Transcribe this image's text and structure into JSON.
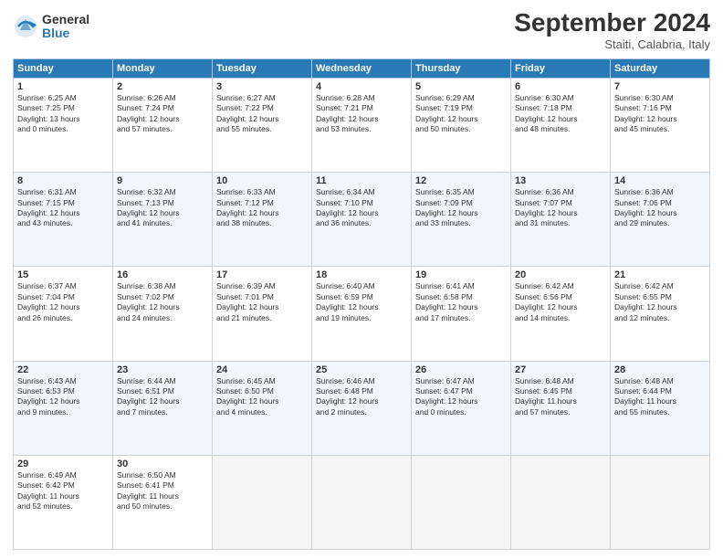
{
  "logo": {
    "general": "General",
    "blue": "Blue"
  },
  "header": {
    "month": "September 2024",
    "location": "Staiti, Calabria, Italy"
  },
  "weekdays": [
    "Sunday",
    "Monday",
    "Tuesday",
    "Wednesday",
    "Thursday",
    "Friday",
    "Saturday"
  ],
  "weeks": [
    [
      {
        "num": "1",
        "info": "Sunrise: 6:25 AM\nSunset: 7:25 PM\nDaylight: 13 hours\nand 0 minutes."
      },
      {
        "num": "2",
        "info": "Sunrise: 6:26 AM\nSunset: 7:24 PM\nDaylight: 12 hours\nand 57 minutes."
      },
      {
        "num": "3",
        "info": "Sunrise: 6:27 AM\nSunset: 7:22 PM\nDaylight: 12 hours\nand 55 minutes."
      },
      {
        "num": "4",
        "info": "Sunrise: 6:28 AM\nSunset: 7:21 PM\nDaylight: 12 hours\nand 53 minutes."
      },
      {
        "num": "5",
        "info": "Sunrise: 6:29 AM\nSunset: 7:19 PM\nDaylight: 12 hours\nand 50 minutes."
      },
      {
        "num": "6",
        "info": "Sunrise: 6:30 AM\nSunset: 7:18 PM\nDaylight: 12 hours\nand 48 minutes."
      },
      {
        "num": "7",
        "info": "Sunrise: 6:30 AM\nSunset: 7:16 PM\nDaylight: 12 hours\nand 45 minutes."
      }
    ],
    [
      {
        "num": "8",
        "info": "Sunrise: 6:31 AM\nSunset: 7:15 PM\nDaylight: 12 hours\nand 43 minutes."
      },
      {
        "num": "9",
        "info": "Sunrise: 6:32 AM\nSunset: 7:13 PM\nDaylight: 12 hours\nand 41 minutes."
      },
      {
        "num": "10",
        "info": "Sunrise: 6:33 AM\nSunset: 7:12 PM\nDaylight: 12 hours\nand 38 minutes."
      },
      {
        "num": "11",
        "info": "Sunrise: 6:34 AM\nSunset: 7:10 PM\nDaylight: 12 hours\nand 36 minutes."
      },
      {
        "num": "12",
        "info": "Sunrise: 6:35 AM\nSunset: 7:09 PM\nDaylight: 12 hours\nand 33 minutes."
      },
      {
        "num": "13",
        "info": "Sunrise: 6:36 AM\nSunset: 7:07 PM\nDaylight: 12 hours\nand 31 minutes."
      },
      {
        "num": "14",
        "info": "Sunrise: 6:36 AM\nSunset: 7:06 PM\nDaylight: 12 hours\nand 29 minutes."
      }
    ],
    [
      {
        "num": "15",
        "info": "Sunrise: 6:37 AM\nSunset: 7:04 PM\nDaylight: 12 hours\nand 26 minutes."
      },
      {
        "num": "16",
        "info": "Sunrise: 6:38 AM\nSunset: 7:02 PM\nDaylight: 12 hours\nand 24 minutes."
      },
      {
        "num": "17",
        "info": "Sunrise: 6:39 AM\nSunset: 7:01 PM\nDaylight: 12 hours\nand 21 minutes."
      },
      {
        "num": "18",
        "info": "Sunrise: 6:40 AM\nSunset: 6:59 PM\nDaylight: 12 hours\nand 19 minutes."
      },
      {
        "num": "19",
        "info": "Sunrise: 6:41 AM\nSunset: 6:58 PM\nDaylight: 12 hours\nand 17 minutes."
      },
      {
        "num": "20",
        "info": "Sunrise: 6:42 AM\nSunset: 6:56 PM\nDaylight: 12 hours\nand 14 minutes."
      },
      {
        "num": "21",
        "info": "Sunrise: 6:42 AM\nSunset: 6:55 PM\nDaylight: 12 hours\nand 12 minutes."
      }
    ],
    [
      {
        "num": "22",
        "info": "Sunrise: 6:43 AM\nSunset: 6:53 PM\nDaylight: 12 hours\nand 9 minutes."
      },
      {
        "num": "23",
        "info": "Sunrise: 6:44 AM\nSunset: 6:51 PM\nDaylight: 12 hours\nand 7 minutes."
      },
      {
        "num": "24",
        "info": "Sunrise: 6:45 AM\nSunset: 6:50 PM\nDaylight: 12 hours\nand 4 minutes."
      },
      {
        "num": "25",
        "info": "Sunrise: 6:46 AM\nSunset: 6:48 PM\nDaylight: 12 hours\nand 2 minutes."
      },
      {
        "num": "26",
        "info": "Sunrise: 6:47 AM\nSunset: 6:47 PM\nDaylight: 12 hours\nand 0 minutes."
      },
      {
        "num": "27",
        "info": "Sunrise: 6:48 AM\nSunset: 6:45 PM\nDaylight: 11 hours\nand 57 minutes."
      },
      {
        "num": "28",
        "info": "Sunrise: 6:48 AM\nSunset: 6:44 PM\nDaylight: 11 hours\nand 55 minutes."
      }
    ],
    [
      {
        "num": "29",
        "info": "Sunrise: 6:49 AM\nSunset: 6:42 PM\nDaylight: 11 hours\nand 52 minutes."
      },
      {
        "num": "30",
        "info": "Sunrise: 6:50 AM\nSunset: 6:41 PM\nDaylight: 11 hours\nand 50 minutes."
      },
      {
        "num": "",
        "info": ""
      },
      {
        "num": "",
        "info": ""
      },
      {
        "num": "",
        "info": ""
      },
      {
        "num": "",
        "info": ""
      },
      {
        "num": "",
        "info": ""
      }
    ]
  ]
}
